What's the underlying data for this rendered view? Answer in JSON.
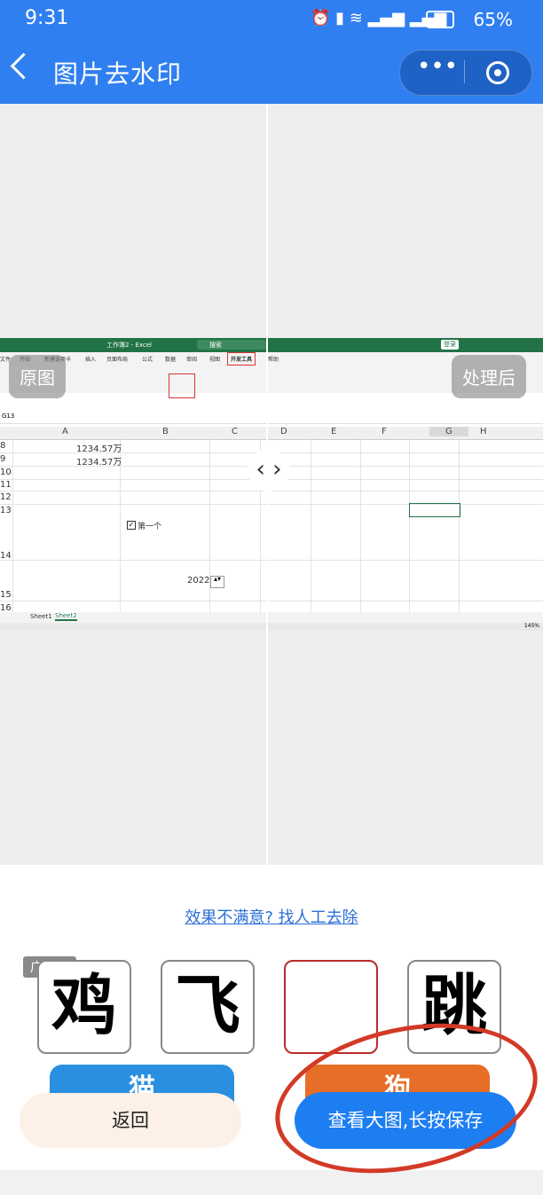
{
  "status": {
    "time": "9:31",
    "battery": "65%"
  },
  "header": {
    "title": "图片去水印"
  },
  "compare": {
    "left_label": "原图",
    "right_label": "处理后"
  },
  "excel": {
    "title_text": "工作簿2 - Excel",
    "search_text": "搜索",
    "login_text": "登录",
    "tabs": [
      "文件",
      "开始",
      "新建选项卡",
      "插入",
      "页面布局",
      "公式",
      "数据",
      "审阅",
      "视图",
      "开发工具",
      "帮助"
    ],
    "name_box": "G13",
    "col_headers": [
      "A",
      "B",
      "C",
      "D",
      "E",
      "F",
      "G",
      "H"
    ],
    "row_numbers": [
      "8",
      "9",
      "10",
      "11",
      "12",
      "13",
      "14",
      "15",
      "16"
    ],
    "cell_a8": "1234.57万",
    "cell_a9": "1234.57万",
    "checkbox_label": "第一个",
    "spinner_value": "2022",
    "sheets": [
      "Sheet1",
      "Sheet2"
    ],
    "zoom": "145%"
  },
  "link_text": "效果不满意? 找人工去除",
  "ad": {
    "tag": "广告",
    "cards": [
      "鸡",
      "飞",
      "",
      "跳"
    ],
    "buttons": [
      "猫",
      "狗"
    ]
  },
  "buttons": {
    "back": "返回",
    "save": "查看大图,长按保存"
  }
}
